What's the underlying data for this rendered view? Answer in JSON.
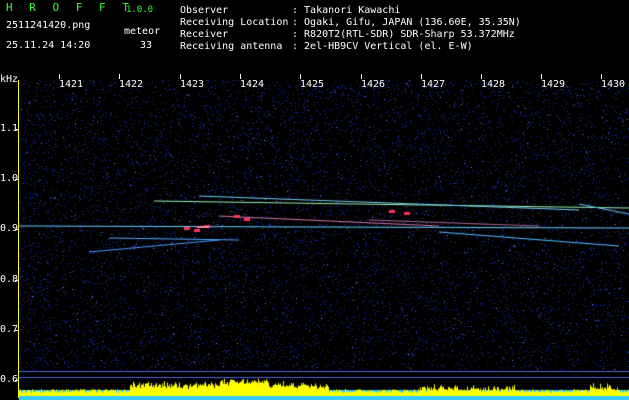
{
  "header": {
    "app_name": "H R O F F T",
    "version": "1.0.0",
    "filename": "2511241420.png",
    "datetime": "25.11.24 14:20",
    "event_label": "meteor",
    "event_count": "33",
    "info": [
      {
        "label": "Observer",
        "value": ": Takanori Kawachi"
      },
      {
        "label": "Receiving Location",
        "value": ": Ogaki, Gifu, JAPAN (136.60E, 35.35N)"
      },
      {
        "label": "Receiver",
        "value": ": R820T2(RTL-SDR) SDR-Sharp 53.372MHz"
      },
      {
        "label": "Receiving antenna",
        "value": ": 2el-HB9CV Vertical (el. E-W)"
      }
    ]
  },
  "axes": {
    "y_unit": "kHz",
    "x_ticks": [
      "1421",
      "1422",
      "1423",
      "1424",
      "1425",
      "1426",
      "1427",
      "1428",
      "1429",
      "1430"
    ],
    "y_ticks": [
      "1.1",
      "1.0",
      "0.9",
      "0.8",
      "0.7",
      "0.6"
    ]
  },
  "colors": {
    "background": "#000000",
    "noise": "#1a2a9a",
    "carrier": "#66ccff",
    "meteor": "#ffff66",
    "hot": "#ff3355",
    "level_bar": "#ffff00",
    "level_base": "#33ccff"
  }
}
